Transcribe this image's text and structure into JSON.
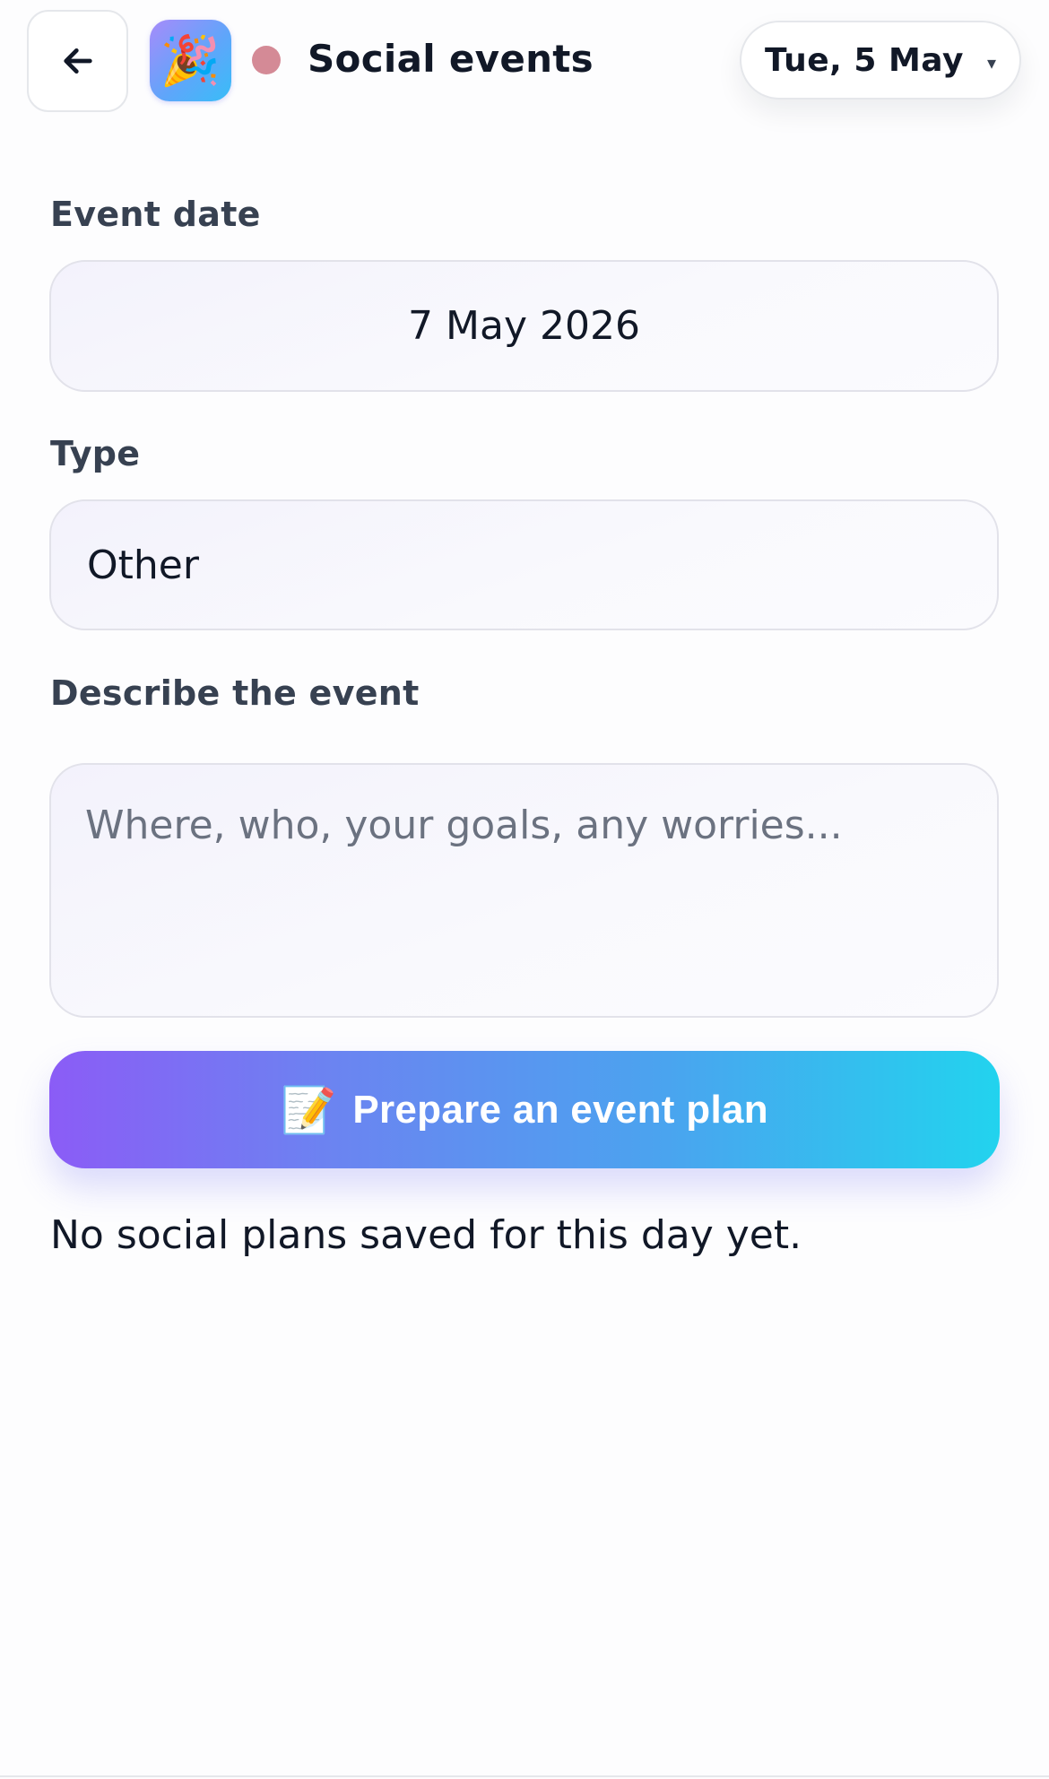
{
  "header": {
    "back_icon": "arrow-left-icon",
    "app_icon_emoji": "🎉",
    "status_color": "#d48a96",
    "title": "Social events",
    "date_selector": {
      "label": "Tue, 5 May",
      "caret": "▾"
    }
  },
  "form": {
    "event_date": {
      "label": "Event date",
      "value": "7 May 2026"
    },
    "type": {
      "label": "Type",
      "value": "Other"
    },
    "description": {
      "label": "Describe the event",
      "value": "",
      "placeholder": "Where, who, your goals, any worries..."
    },
    "submit": {
      "icon": "📝",
      "label": "Prepare an event plan"
    }
  },
  "empty_state": "No social plans saved for this day yet.",
  "colors": {
    "accent_start": "#8b5cf6",
    "accent_end": "#22d3ee",
    "field_border": "#e2e2ea",
    "label": "#374151"
  }
}
